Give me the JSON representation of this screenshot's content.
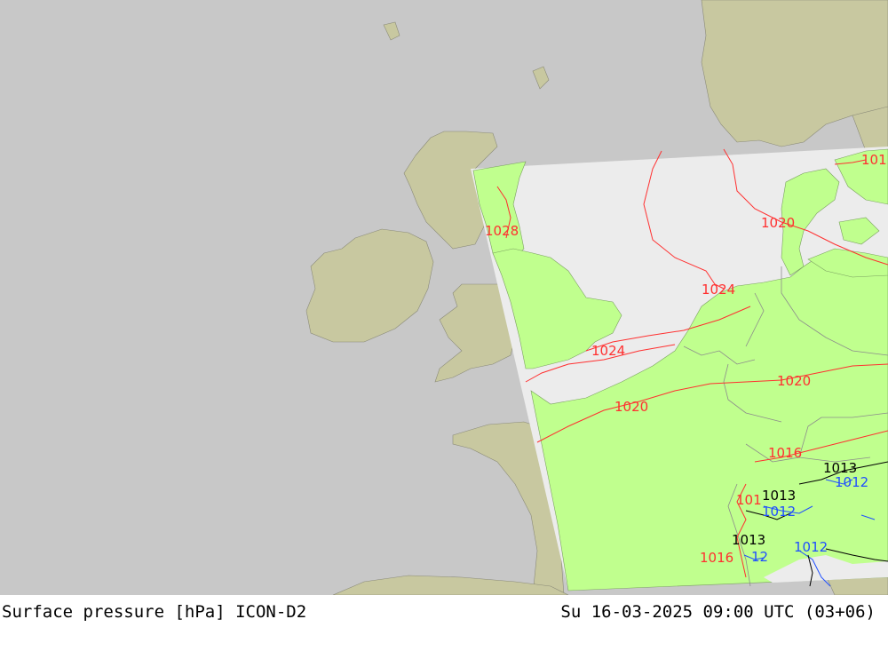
{
  "footer": {
    "left": "Surface pressure [hPa] ICON-D2",
    "right": "Su 16-03-2025 09:00 UTC (03+06)"
  },
  "colors": {
    "sea_outside": "#c8c8c8",
    "land_outside": "#c8c8a0",
    "sea_domain": "#ececec",
    "land_domain": "#c0ff8e",
    "isobar_red": "#ff3030",
    "isobar_blue": "#1f4fff",
    "isobar_black": "#000000",
    "borders": "#9a9a9a"
  },
  "isobar_labels": [
    {
      "id": "lbl-1028",
      "text": "1028",
      "color": "red"
    },
    {
      "id": "lbl-1020-ne",
      "text": "1020",
      "color": "red"
    },
    {
      "id": "lbl-101-ne",
      "text": "101",
      "color": "red"
    },
    {
      "id": "lbl-1024-nl",
      "text": "1024",
      "color": "red"
    },
    {
      "id": "lbl-1024-ch",
      "text": "1024",
      "color": "red"
    },
    {
      "id": "lbl-1020-de",
      "text": "1020",
      "color": "red"
    },
    {
      "id": "lbl-1020-fr",
      "text": "1020",
      "color": "red"
    },
    {
      "id": "lbl-1016-alps",
      "text": "1016",
      "color": "red"
    },
    {
      "id": "lbl-1013-a",
      "text": "1013",
      "color": "black"
    },
    {
      "id": "lbl-1013-b",
      "text": "1013",
      "color": "black"
    },
    {
      "id": "lbl-1012-a",
      "text": "1012",
      "color": "blue"
    },
    {
      "id": "lbl-101-w",
      "text": "101",
      "color": "red"
    },
    {
      "id": "lbl-1013-c",
      "text": "1013",
      "color": "black"
    },
    {
      "id": "lbl-1016-sw",
      "text": "1016",
      "color": "red"
    },
    {
      "id": "lbl-1012-b",
      "text": "1012",
      "color": "blue"
    },
    {
      "id": "lbl-1012-c",
      "text": "1012",
      "color": "blue"
    },
    {
      "id": "lbl-12-a",
      "text": "12",
      "color": "blue"
    }
  ]
}
